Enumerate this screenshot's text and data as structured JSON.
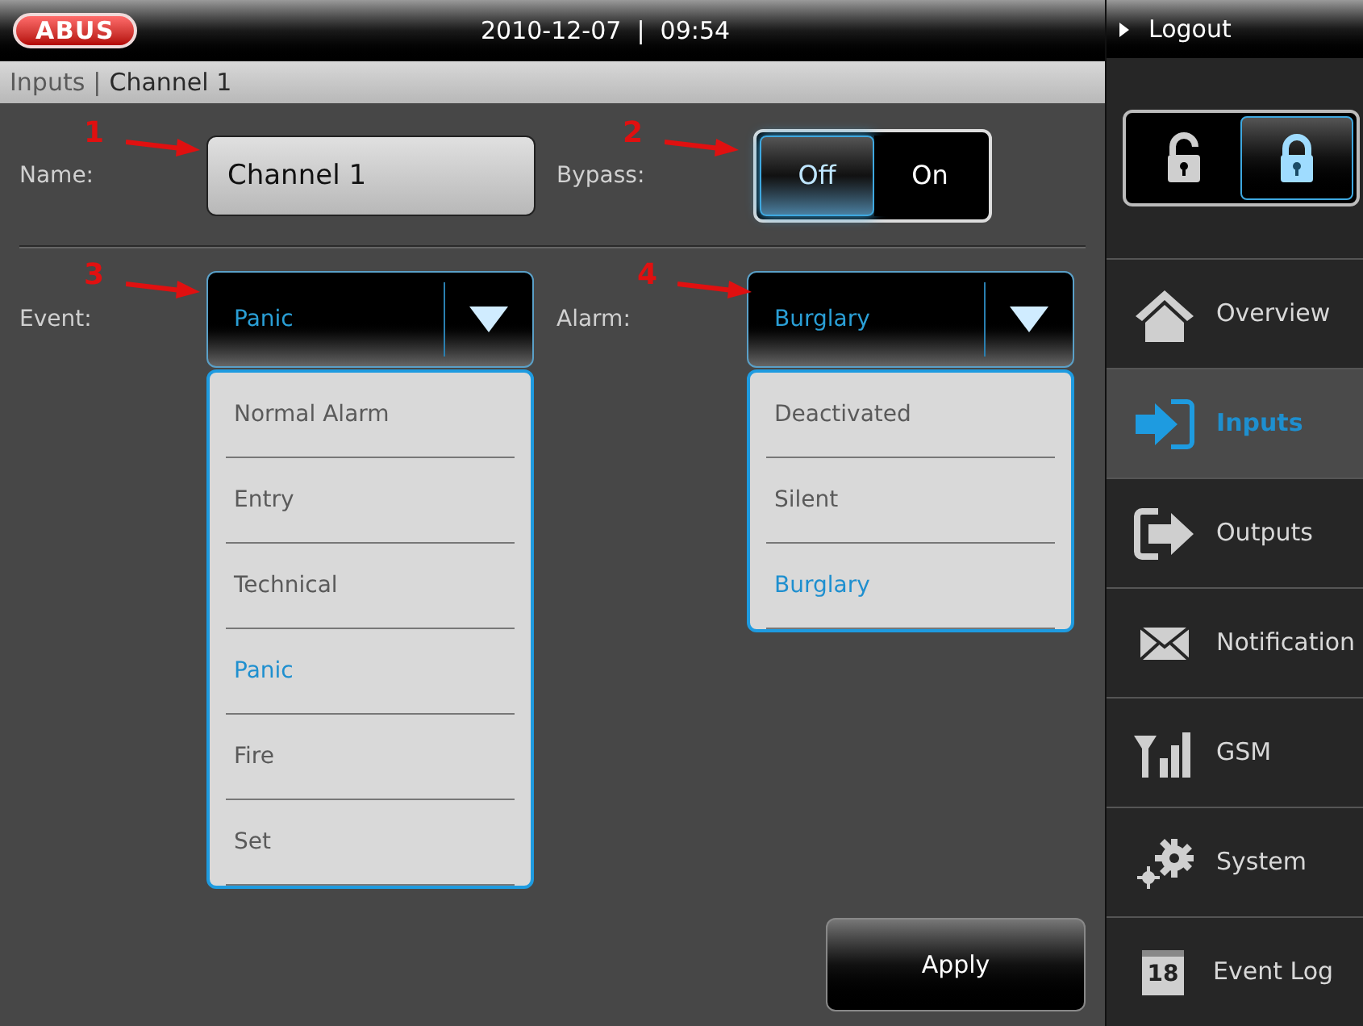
{
  "header": {
    "logo": "ABUS",
    "datetime": "2010-12-07  |  09:54"
  },
  "breadcrumb": {
    "section": "Inputs",
    "separator": "|",
    "page": "Channel 1"
  },
  "form": {
    "name_label": "Name:",
    "name_value": "Channel 1",
    "bypass_label": "Bypass:",
    "bypass_options": [
      {
        "label": "Off",
        "selected": true
      },
      {
        "label": "On",
        "selected": false
      }
    ],
    "event_label": "Event:",
    "event_value": "Panic",
    "event_options": [
      {
        "label": "Normal Alarm",
        "selected": false
      },
      {
        "label": "Entry",
        "selected": false
      },
      {
        "label": "Technical",
        "selected": false
      },
      {
        "label": "Panic",
        "selected": true
      },
      {
        "label": "Fire",
        "selected": false
      },
      {
        "label": "Set",
        "selected": false
      }
    ],
    "alarm_label": "Alarm:",
    "alarm_value": "Burglary",
    "alarm_options": [
      {
        "label": "Deactivated",
        "selected": false
      },
      {
        "label": "Silent",
        "selected": false
      },
      {
        "label": "Burglary",
        "selected": true
      }
    ],
    "apply_button": "Apply"
  },
  "annotations": [
    {
      "label": "1"
    },
    {
      "label": "2"
    },
    {
      "label": "3"
    },
    {
      "label": "4"
    }
  ],
  "sidebar": {
    "logout": "Logout",
    "lock_toggle": [
      {
        "kind": "unlocked",
        "selected": false
      },
      {
        "kind": "locked",
        "selected": true
      }
    ],
    "items": [
      {
        "label": "Overview",
        "kind": "home",
        "selected": false
      },
      {
        "label": "Inputs",
        "kind": "input",
        "selected": true
      },
      {
        "label": "Outputs",
        "kind": "output",
        "selected": false
      },
      {
        "label": "Notification",
        "kind": "mail",
        "selected": false
      },
      {
        "label": "GSM",
        "kind": "signal",
        "selected": false
      },
      {
        "label": "System",
        "kind": "gears",
        "selected": false
      },
      {
        "label": "Event Log",
        "kind": "calendar",
        "selected": false,
        "icon_text": "18"
      }
    ]
  }
}
